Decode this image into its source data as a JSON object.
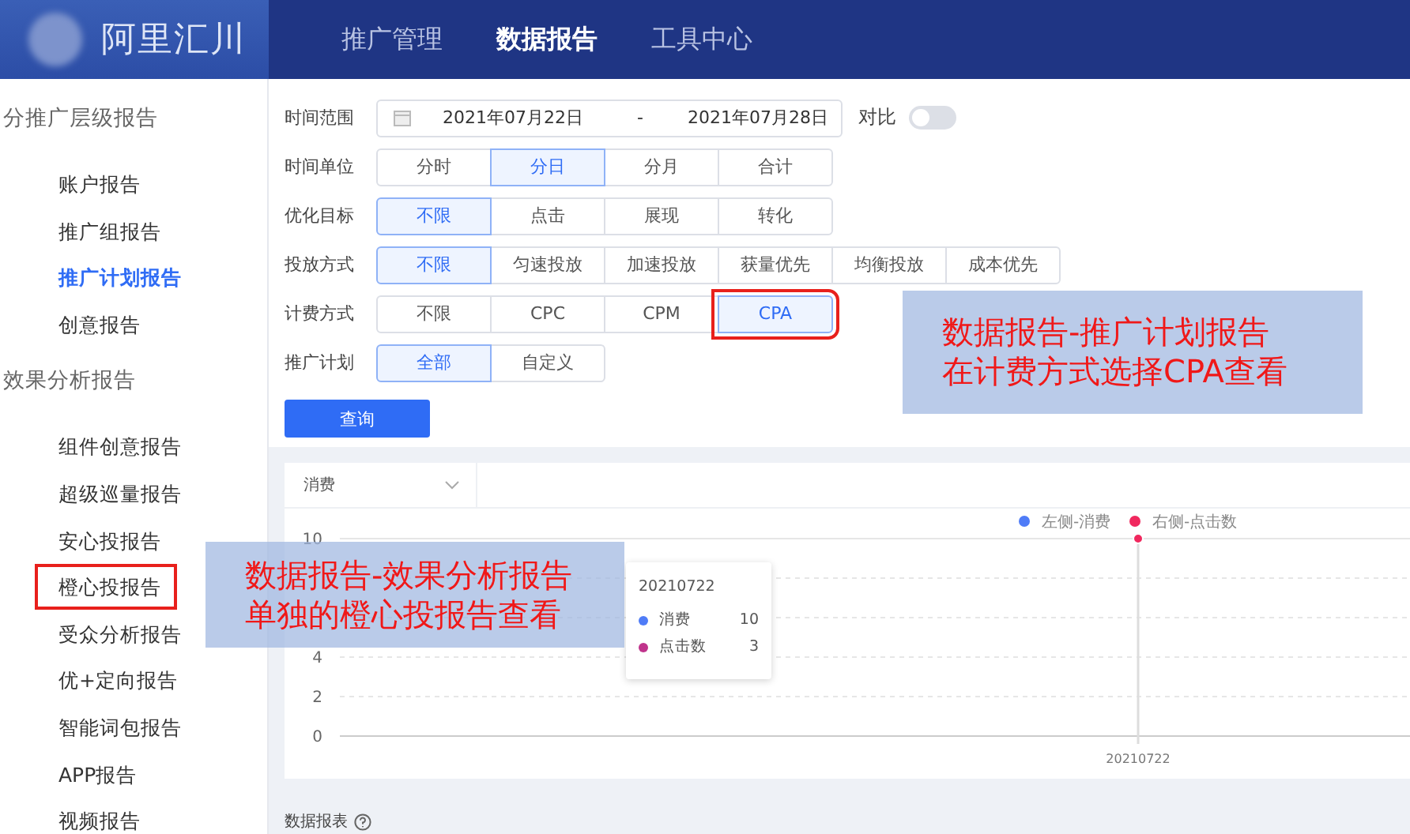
{
  "topbar": {
    "brand": "阿里汇川",
    "nav": [
      {
        "label": "推广管理",
        "selected": false
      },
      {
        "label": "数据报告",
        "selected": true
      },
      {
        "label": "工具中心",
        "selected": false
      }
    ]
  },
  "sidebar": {
    "sections": [
      {
        "title": "分推广层级报告",
        "items": [
          {
            "label": "账户报告",
            "selected": false,
            "highlighted": false
          },
          {
            "label": "推广组报告",
            "selected": false,
            "highlighted": false
          },
          {
            "label": "推广计划报告",
            "selected": true,
            "highlighted": false
          },
          {
            "label": "创意报告",
            "selected": false,
            "highlighted": false
          }
        ]
      },
      {
        "title": "效果分析报告",
        "items": [
          {
            "label": "组件创意报告",
            "selected": false,
            "highlighted": false
          },
          {
            "label": "超级巡量报告",
            "selected": false,
            "highlighted": false
          },
          {
            "label": "安心投报告",
            "selected": false,
            "highlighted": false
          },
          {
            "label": "橙心投报告",
            "selected": false,
            "highlighted": true
          },
          {
            "label": "受众分析报告",
            "selected": false,
            "highlighted": false
          },
          {
            "label": "优+定向报告",
            "selected": false,
            "highlighted": false
          },
          {
            "label": "智能词包报告",
            "selected": false,
            "highlighted": false
          },
          {
            "label": "APP报告",
            "selected": false,
            "highlighted": false
          },
          {
            "label": "视频报告",
            "selected": false,
            "highlighted": false
          }
        ]
      }
    ]
  },
  "filters": [
    {
      "kind": "date",
      "label": "时间范围",
      "start": "2021年07月22日",
      "separator": "-",
      "end": "2021年07月28日",
      "compare": {
        "label": "对比",
        "on": false
      }
    },
    {
      "kind": "segments",
      "label": "时间单位",
      "options": [
        {
          "label": "分时",
          "selected": false,
          "highlighted": false
        },
        {
          "label": "分日",
          "selected": true,
          "highlighted": false
        },
        {
          "label": "分月",
          "selected": false,
          "highlighted": false
        },
        {
          "label": "合计",
          "selected": false,
          "highlighted": false
        }
      ]
    },
    {
      "kind": "segments",
      "label": "优化目标",
      "options": [
        {
          "label": "不限",
          "selected": true,
          "highlighted": false
        },
        {
          "label": "点击",
          "selected": false,
          "highlighted": false
        },
        {
          "label": "展现",
          "selected": false,
          "highlighted": false
        },
        {
          "label": "转化",
          "selected": false,
          "highlighted": false
        }
      ]
    },
    {
      "kind": "segments",
      "label": "投放方式",
      "options": [
        {
          "label": "不限",
          "selected": true,
          "highlighted": false
        },
        {
          "label": "匀速投放",
          "selected": false,
          "highlighted": false
        },
        {
          "label": "加速投放",
          "selected": false,
          "highlighted": false
        },
        {
          "label": "获量优先",
          "selected": false,
          "highlighted": false
        },
        {
          "label": "均衡投放",
          "selected": false,
          "highlighted": false
        },
        {
          "label": "成本优先",
          "selected": false,
          "highlighted": false
        }
      ]
    },
    {
      "kind": "segments",
      "label": "计费方式",
      "options": [
        {
          "label": "不限",
          "selected": false,
          "highlighted": false
        },
        {
          "label": "CPC",
          "selected": false,
          "highlighted": false
        },
        {
          "label": "CPM",
          "selected": false,
          "highlighted": false
        },
        {
          "label": "CPA",
          "selected": true,
          "highlighted": true
        }
      ]
    },
    {
      "kind": "segments",
      "label": "推广计划",
      "options": [
        {
          "label": "全部",
          "selected": true,
          "highlighted": false
        },
        {
          "label": "自定义",
          "selected": false,
          "highlighted": false
        }
      ]
    }
  ],
  "query_button": "查询",
  "chart": {
    "metric_select": "消费",
    "legend": [
      {
        "name": "左侧-消费",
        "color": "#4f7cf7"
      },
      {
        "name": "右侧-点击数",
        "color": "#f0285e"
      }
    ],
    "y_axis_labels": [
      "10",
      "4",
      "2",
      "0"
    ],
    "x_axis_labels": [
      "20210722"
    ],
    "tooltip": {
      "title": "20210722",
      "rows": [
        {
          "name": "消费",
          "value": "10",
          "color": "#4f7cf7"
        },
        {
          "name": "点击数",
          "value": "3",
          "color": "#c0348c"
        }
      ]
    }
  },
  "table_title": "数据报表",
  "callouts": [
    {
      "lines": [
        "数据报告-推广计划报告",
        "在计费方式选择CPA查看"
      ]
    },
    {
      "lines": [
        "数据报告-效果分析报告",
        "单独的橙心投报告查看"
      ]
    }
  ]
}
